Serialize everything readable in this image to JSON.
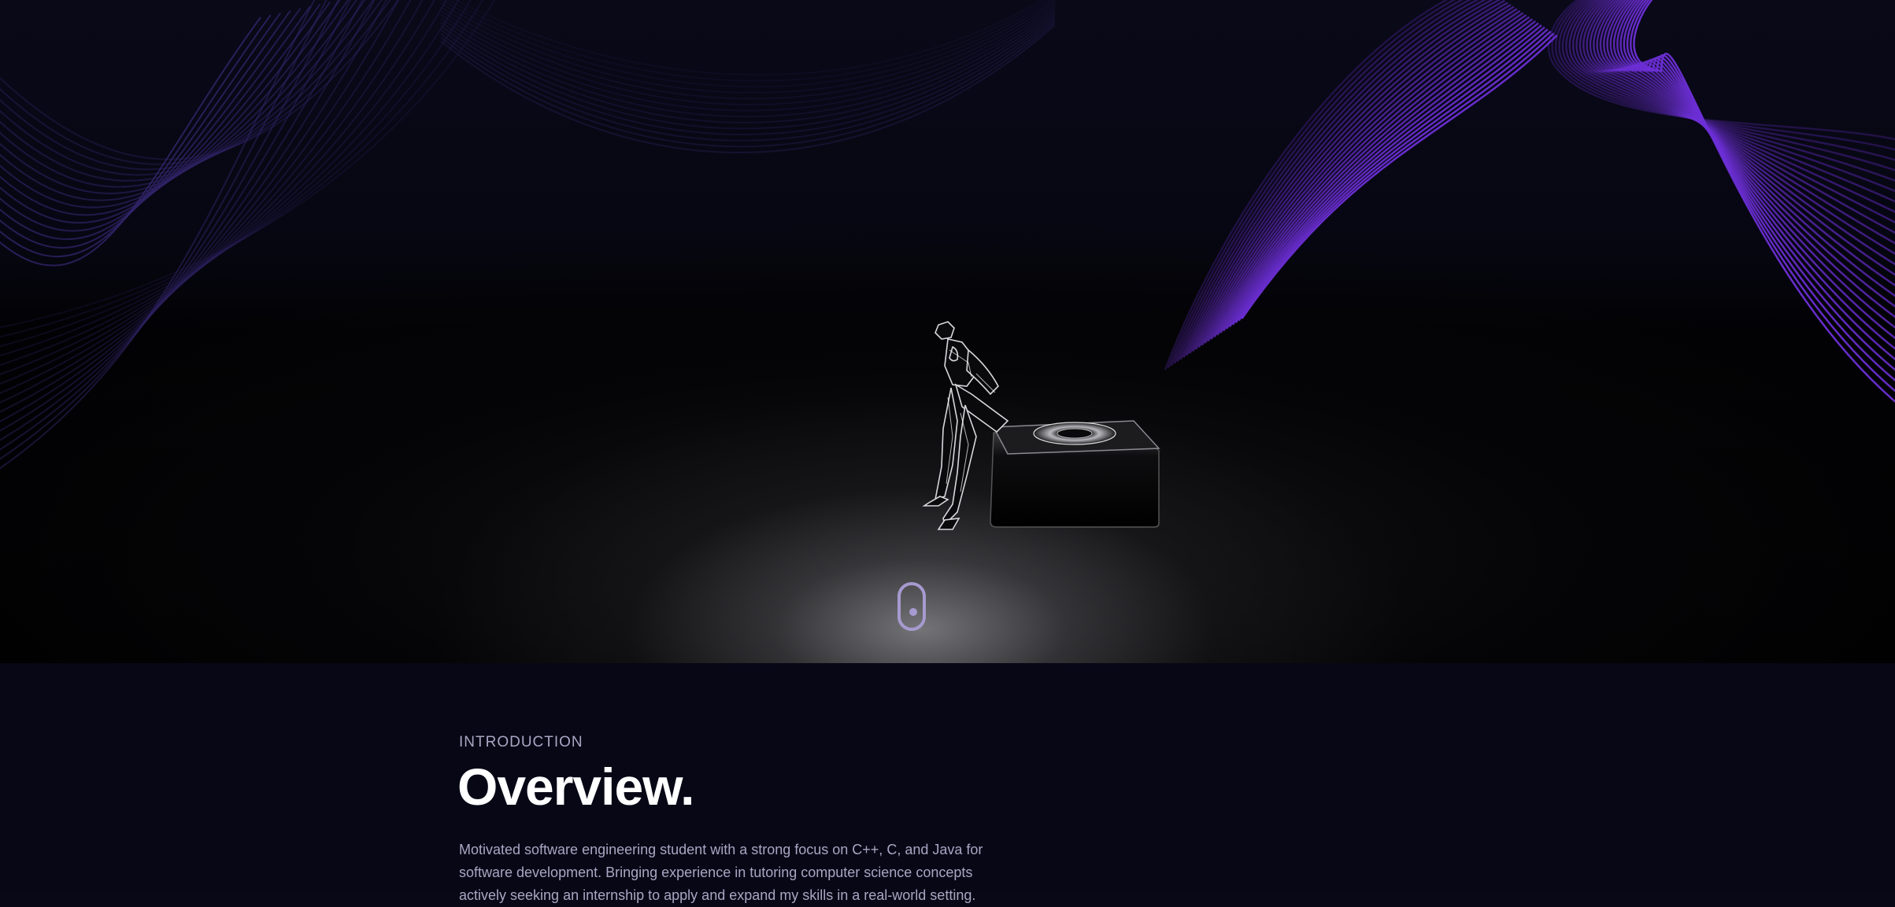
{
  "hero": {
    "background_color": "#080816",
    "wave_color_left": "#3a2a7a",
    "wave_color_right": "#6d2fd6",
    "scroll_indicator_color": "#a79ad0"
  },
  "overview": {
    "subtitle": "INTRODUCTION",
    "title": "Overview.",
    "description_lines": [
      "Motivated software engineering student with a strong focus on C++, C, and Java for",
      "software development. Bringing experience in tutoring computer science concepts",
      "actively seeking an internship to apply and expand my skills in a real-world setting."
    ]
  }
}
